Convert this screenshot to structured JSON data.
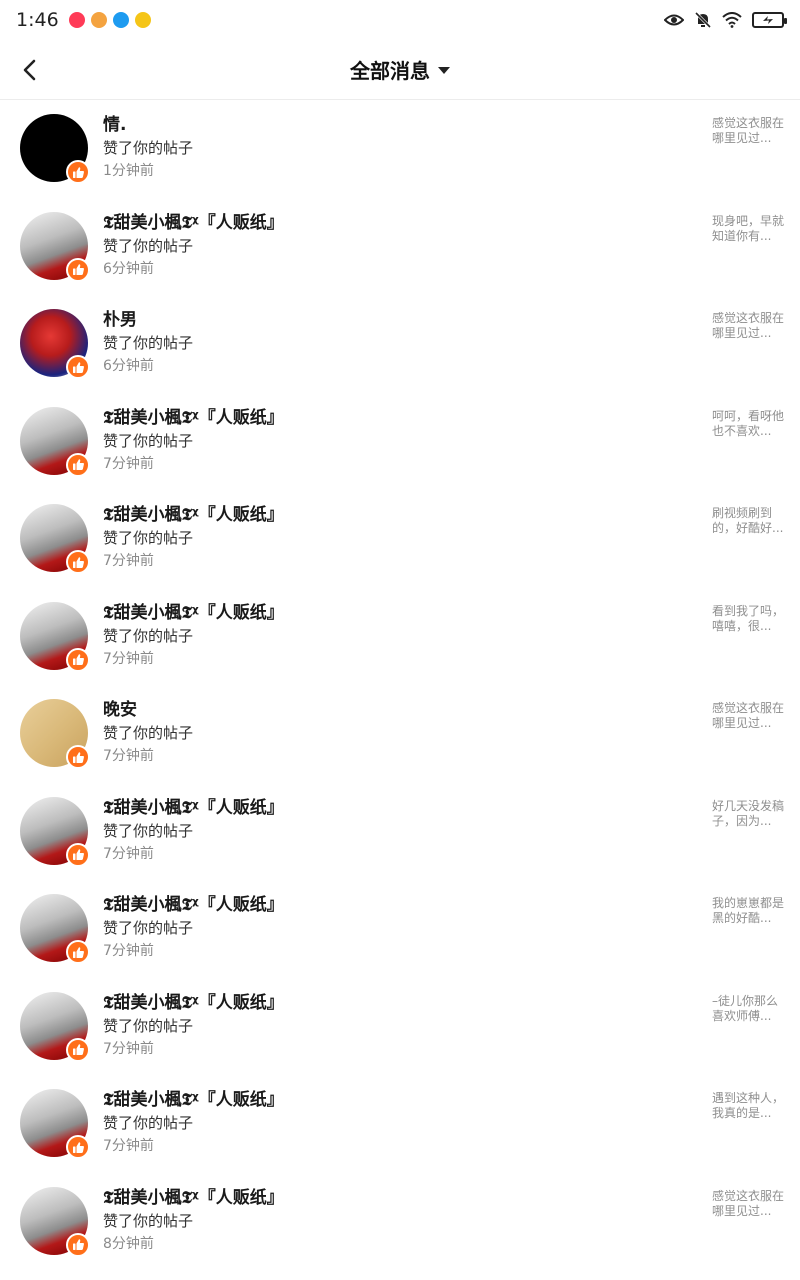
{
  "status_bar": {
    "time": "1:46",
    "app_dots": [
      {
        "icon": "news-app-icon",
        "color": "#ff3b57"
      },
      {
        "icon": "monkey-app-icon",
        "color": "#f4a340"
      },
      {
        "icon": "cloud-app-icon",
        "color": "#1e9bf0"
      },
      {
        "icon": "shield-app-icon",
        "color": "#f5c518"
      }
    ]
  },
  "header": {
    "title": "全部消息"
  },
  "messages": [
    {
      "name": "情.",
      "action": "赞了你的帖子",
      "time": "1分钟前",
      "preview": "感觉这衣服在哪里见过...",
      "avatar": "black"
    },
    {
      "name": "𝕿甜美小楓𝕿ᵡ『人贩纸』",
      "action": "赞了你的帖子",
      "time": "6分钟前",
      "preview": "现身吧，早就知道你有...",
      "avatar": "maple"
    },
    {
      "name": "朴男",
      "action": "赞了你的帖子",
      "time": "6分钟前",
      "preview": "感觉这衣服在哪里见过...",
      "avatar": "spider"
    },
    {
      "name": "𝕿甜美小楓𝕿ᵡ『人贩纸』",
      "action": "赞了你的帖子",
      "time": "7分钟前",
      "preview": "呵呵，看呀他也不喜欢...",
      "avatar": "maple"
    },
    {
      "name": "𝕿甜美小楓𝕿ᵡ『人贩纸』",
      "action": "赞了你的帖子",
      "time": "7分钟前",
      "preview": "刷视频刷到的，好酷好...",
      "avatar": "maple"
    },
    {
      "name": "𝕿甜美小楓𝕿ᵡ『人贩纸』",
      "action": "赞了你的帖子",
      "time": "7分钟前",
      "preview": "看到我了吗，嘻嘻，很...",
      "avatar": "maple"
    },
    {
      "name": "晚安",
      "action": "赞了你的帖子",
      "time": "7分钟前",
      "preview": "感觉这衣服在哪里见过...",
      "avatar": "box"
    },
    {
      "name": "𝕿甜美小楓𝕿ᵡ『人贩纸』",
      "action": "赞了你的帖子",
      "time": "7分钟前",
      "preview": "好几天没发稿子，因为...",
      "avatar": "maple"
    },
    {
      "name": "𝕿甜美小楓𝕿ᵡ『人贩纸』",
      "action": "赞了你的帖子",
      "time": "7分钟前",
      "preview": "我的崽崽都是黑的好酷...",
      "avatar": "maple"
    },
    {
      "name": "𝕿甜美小楓𝕿ᵡ『人贩纸』",
      "action": "赞了你的帖子",
      "time": "7分钟前",
      "preview": "–徒儿你那么喜欢师傅...",
      "avatar": "maple"
    },
    {
      "name": "𝕿甜美小楓𝕿ᵡ『人贩纸』",
      "action": "赞了你的帖子",
      "time": "7分钟前",
      "preview": "遇到这种人，我真的是...",
      "avatar": "maple"
    },
    {
      "name": "𝕿甜美小楓𝕿ᵡ『人贩纸』",
      "action": "赞了你的帖子",
      "time": "8分钟前",
      "preview": "感觉这衣服在哪里见过...",
      "avatar": "maple"
    }
  ],
  "colors": {
    "like_badge": "#ff6f1a"
  }
}
